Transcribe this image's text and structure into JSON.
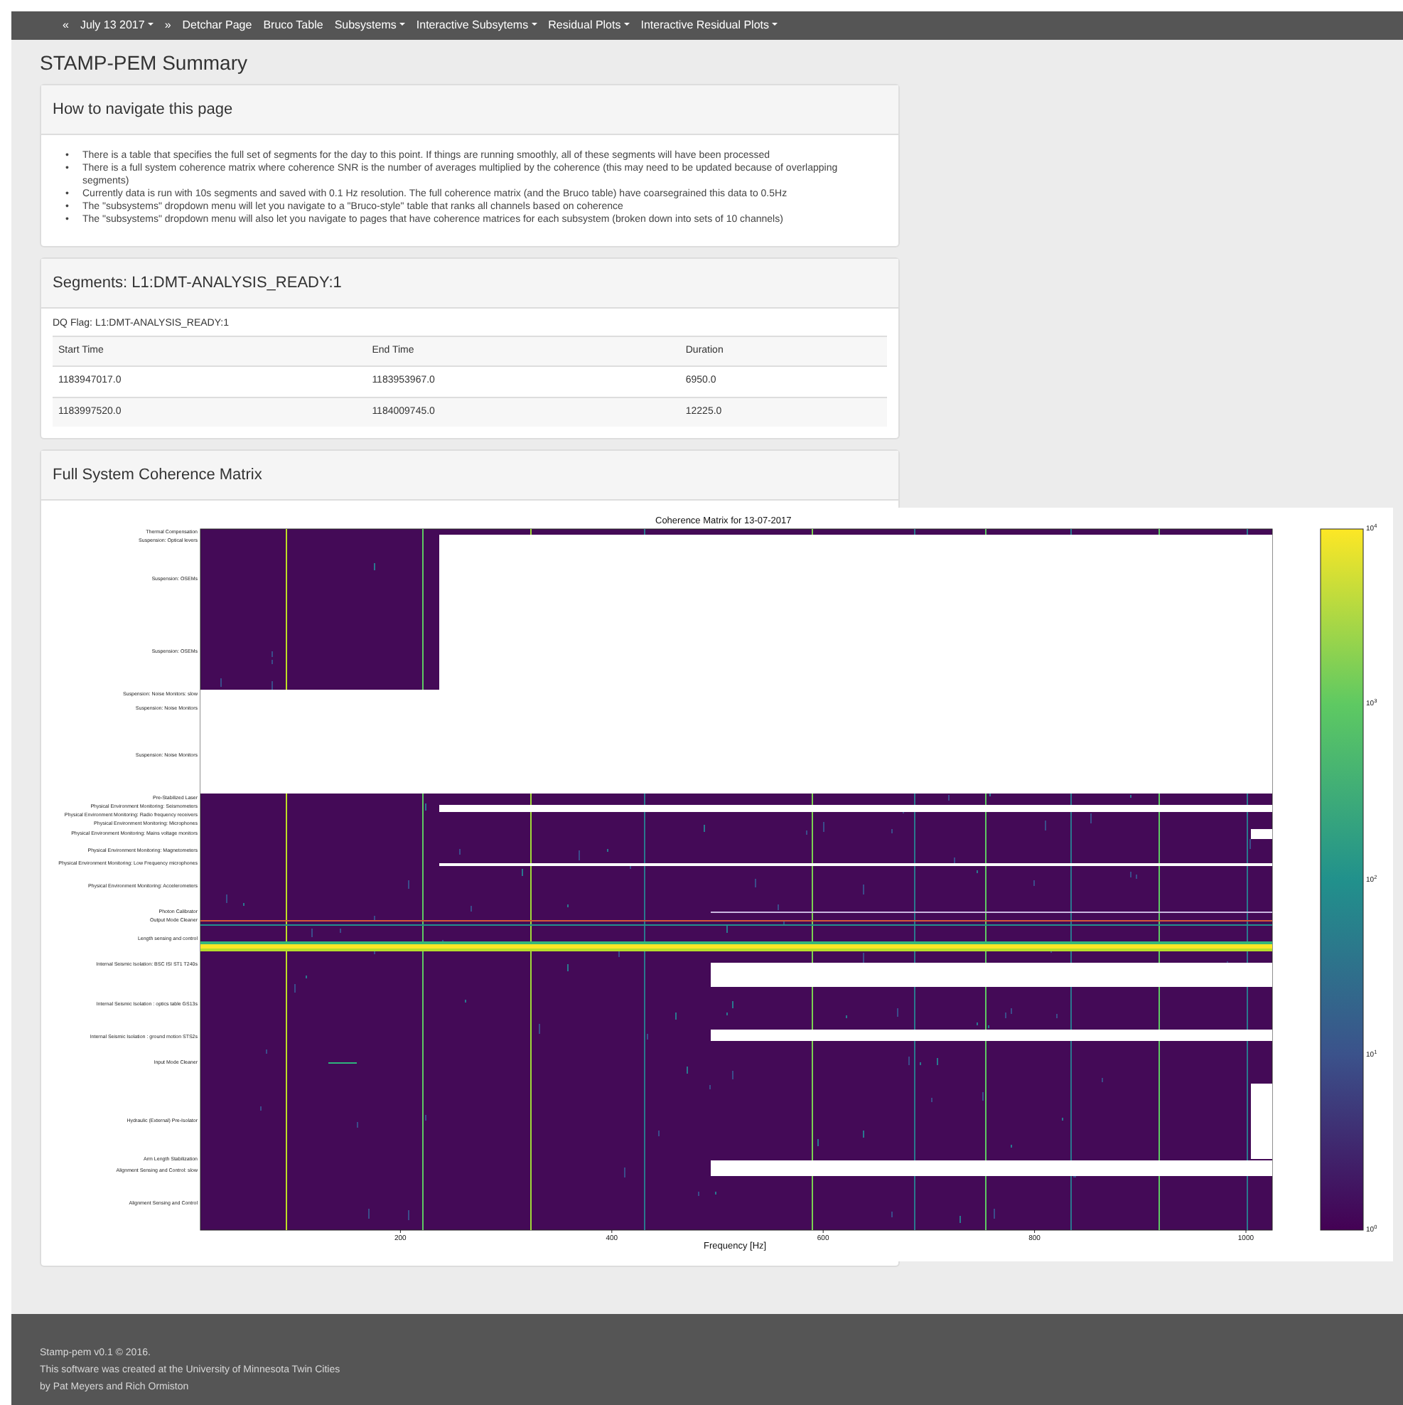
{
  "navbar": {
    "items": [
      {
        "label": "«",
        "kind": "link"
      },
      {
        "label": "July 13 2017",
        "kind": "dropdown"
      },
      {
        "label": "»",
        "kind": "link"
      },
      {
        "label": "Detchar Page",
        "kind": "link"
      },
      {
        "label": "Bruco Table",
        "kind": "link"
      },
      {
        "label": "Subsystems",
        "kind": "dropdown"
      },
      {
        "label": "Interactive Subsytems",
        "kind": "dropdown"
      },
      {
        "label": "Residual Plots",
        "kind": "dropdown"
      },
      {
        "label": "Interactive Residual Plots",
        "kind": "dropdown"
      }
    ]
  },
  "page_title": "STAMP-PEM Summary",
  "panels": [
    {
      "kind": "list",
      "title": "How to navigate this page",
      "items": [
        {
          "marker": "•",
          "text": "There is a table that specifies the full set of segments for the day to this point. If things are running smoothly, all of these segments will have been processed"
        },
        {
          "marker": "•",
          "text": "There is a full system coherence matrix where coherence SNR is the number of averages multiplied by the coherence (this may need to be updated because of overlapping segments)"
        },
        {
          "marker": "•",
          "text": "Currently data is run with 10s segments and saved with 0.1 Hz resolution. The full coherence matrix (and the Bruco table) have coarsegrained this data to 0.5Hz"
        },
        {
          "marker": "•",
          "text": "The \"subsystems\" dropdown menu will let you navigate to a \"Bruco-style\" table that ranks all channels based on coherence"
        },
        {
          "marker": "•",
          "text": "The \"subsystems\" dropdown menu will also let you navigate to pages that have coherence matrices for each subsystem (broken down into sets of 10 channels)"
        }
      ]
    },
    {
      "kind": "table",
      "title": "Segments: L1:DMT-ANALYSIS_READY:1",
      "caption": "DQ Flag: L1:DMT-ANALYSIS_READY:1",
      "columns": [
        "Start Time",
        "End Time",
        "Duration"
      ],
      "rows": [
        [
          "1183947017.0",
          "1183953967.0",
          "6950.0"
        ],
        [
          "1183997520.0",
          "1184009745.0",
          "12225.0"
        ]
      ]
    },
    {
      "kind": "figure",
      "title": "Full System Coherence Matrix",
      "figure": {
        "title": "Coherence Matrix for 13-07-2017",
        "xlabel": "Frequency [Hz]",
        "xticks": [
          "200",
          "400",
          "600",
          "800",
          "1000"
        ],
        "ylabels": [
          "Thermal Compensation",
          "Suspension: Optical levers",
          "Suspension: OSEMs",
          "Suspension: OSEMs",
          "Suspension: Noise Monitors: slow",
          "Suspension: Noise Monitors",
          "Suspension: Noise Monitors",
          "Pre-Stabilized Laser",
          "Physical Environment Monitoring: Seismometers",
          "Physical Environment Monitoring: Radio frequency receivers",
          "Physical Environment Monitoring: Microphones",
          "Physical Environment Monitoring: Mains voltage monitors",
          "Physical Environment Monitoring: Magnetometers",
          "Physical Environment Monitoring: Low Frequency microphones",
          "Physical Environment Monitoring: Accelerometers",
          "Photon Calibrator",
          "Output Mode Cleaner",
          "Length sensing and control",
          "Internal Seismic Isolation: BSC ISI ST1 T240s",
          "Internal Seismic Isolation : optics table GS13s",
          "Internal Seismic Isolation : ground motion STS2s",
          "Input Mode Cleaner",
          "Hydraulic (External) Pre-Isolator",
          "Arm Length Stabilization",
          "Alignment Sensing and Control: slow",
          "Alignment Sensing and Control"
        ],
        "colorbar_ticks": [
          "10$^{4}$",
          "10$^{3}$",
          "10$^{2}$",
          "10$^{1}$",
          "10$^{0}$"
        ]
      }
    }
  ],
  "footer": [
    "Stamp-pem v0.1 © 2016.",
    "This software was created at the University of Minnesota Twin Cities",
    "by Pat Meyers and Rich Ormiston"
  ]
}
